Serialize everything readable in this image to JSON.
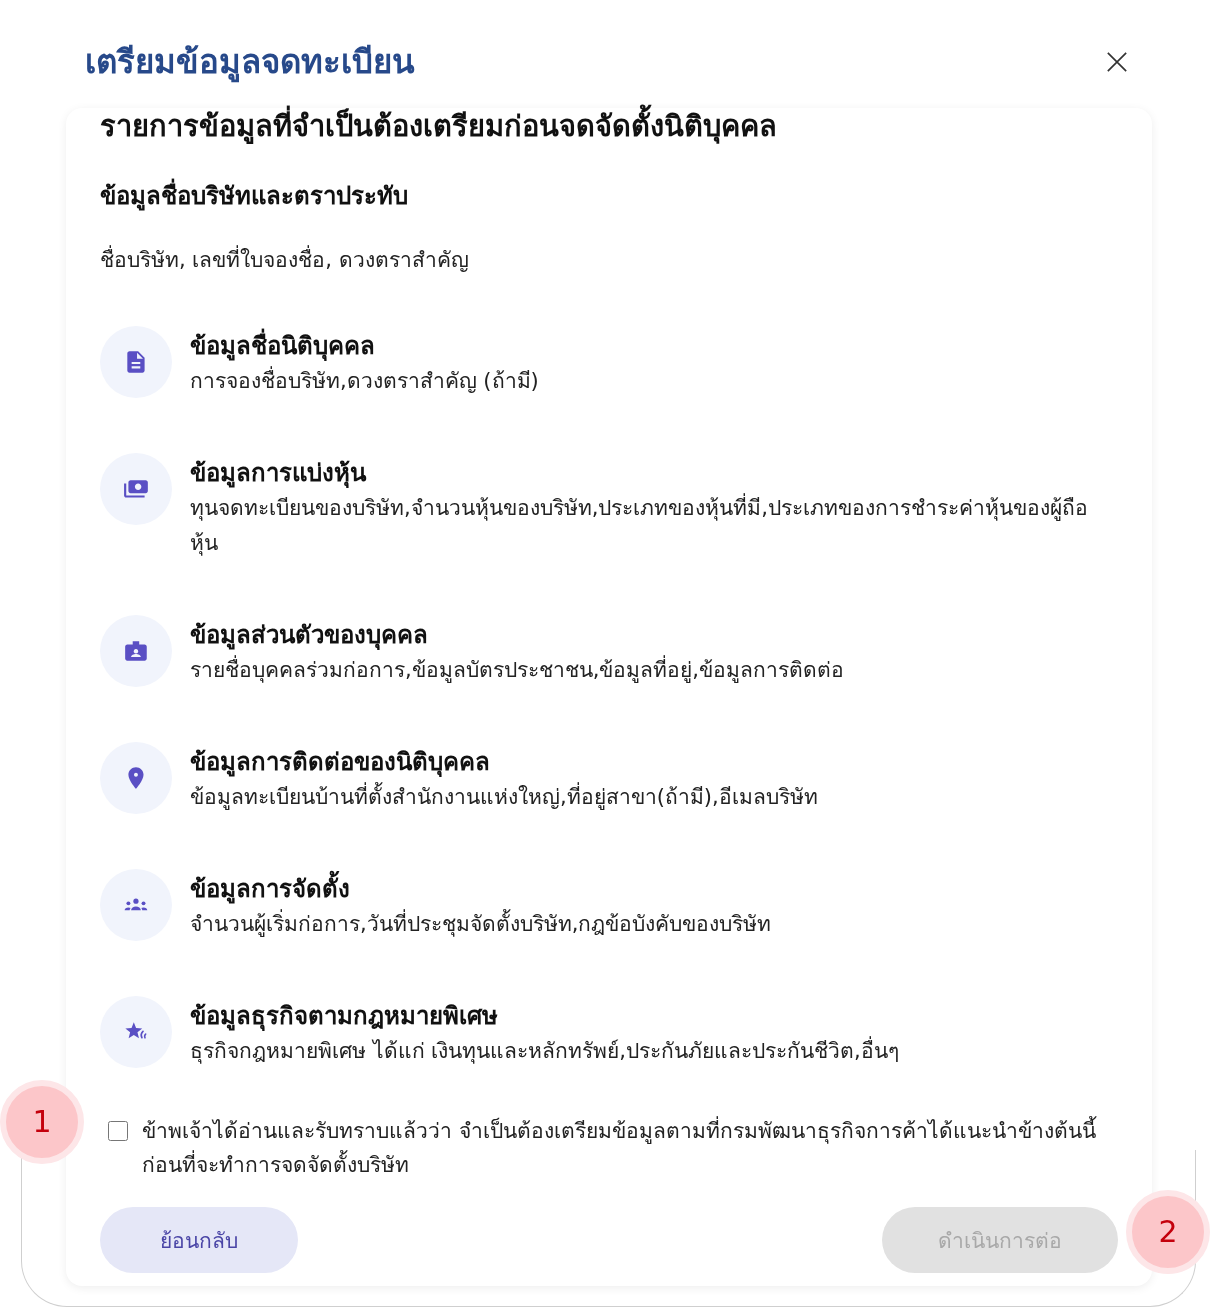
{
  "dialog": {
    "title": "เตรียมข้อมูลจดทะเบียน"
  },
  "card": {
    "heading": "รายการข้อมูลที่จำเป็นต้องเตรียมก่อนจดจัดตั้งนิติบุคคล",
    "section_title": "ข้อมูลชื่อบริษัทและตราประทับ",
    "section_text": "ชื่อบริษัท, เลขที่ใบจองชื่อ, ดวงตราสำคัญ",
    "items": [
      {
        "kind": "document",
        "title": "ข้อมูลชื่อนิติบุคคล",
        "description": "การจองชื่อบริษัท,ดวงตราสำคัญ (ถ้ามี)"
      },
      {
        "kind": "money",
        "title": "ข้อมูลการแบ่งหุ้น",
        "description": "ทุนจดทะเบียนของบริษัท,จำนวนหุ้นของบริษัท,ประเภทของหุ้นที่มี,ประเภทของการชำระค่าหุ้นของผู้ถือหุ้น"
      },
      {
        "kind": "badge",
        "title": "ข้อมูลส่วนตัวของบุคคล",
        "description": "รายชื่อบุคคลร่วมก่อการ,ข้อมูลบัตรประชาชน,ข้อมูลที่อยู่,ข้อมูลการติดต่อ"
      },
      {
        "kind": "pin",
        "title": "ข้อมูลการติดต่อของนิติบุคคล",
        "description": "ข้อมูลทะเบียนบ้านที่ตั้งสำนักงานแห่งใหญ่,ที่อยู่สาขา(ถ้ามี),อีเมลบริษัท"
      },
      {
        "kind": "group",
        "title": "ข้อมูลการจัดตั้ง",
        "description": "จำนวนผู้เริ่มก่อการ,วันที่ประชุมจัดตั้งบริษัท,กฎข้อบังคับของบริษัท"
      },
      {
        "kind": "star",
        "title": "ข้อมูลธุรกิจตามกฎหมายพิเศษ",
        "description": "ธุรกิจกฎหมายพิเศษ ได้แก่ เงินทุนและหลักทรัพย์,ประกันภัยและประกันชีวิต,อื่นๆ"
      }
    ],
    "consent": {
      "checked": false,
      "text": "ข้าพเจ้าได้อ่านและรับทราบแล้วว่า จำเป็นต้องเตรียมข้อมูลตามที่กรมพัฒนาธุรกิจการค้าได้แนะนำข้างต้นนี้ ก่อนที่จะทำการจดจัดตั้งบริษัท"
    },
    "buttons": [
      {
        "kind": "back",
        "label": "ย้อนกลับ",
        "disabled": false
      },
      {
        "kind": "next",
        "label": "ดำเนินการต่อ",
        "disabled": true
      }
    ]
  },
  "callouts": [
    {
      "label": "1"
    },
    {
      "label": "2"
    }
  ]
}
